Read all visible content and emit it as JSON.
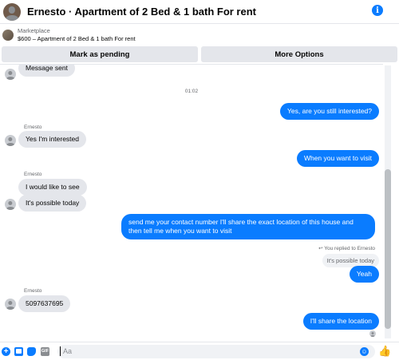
{
  "header": {
    "title": "Ernesto · Apartment of 2 Bed & 1 bath For rent",
    "info_icon": "info-icon",
    "info_glyph": "i"
  },
  "marketplace": {
    "kicker": "Marketplace",
    "listing": "$600 – Apartment of 2 Bed & 1 bath For rent"
  },
  "actions": {
    "pending_label": "Mark as pending",
    "more_label": "More Options"
  },
  "messages": [
    {
      "dir": "in",
      "text": "Message sent"
    },
    {
      "timestamp": "01:02"
    },
    {
      "dir": "out",
      "text": "Yes, are you still interested?"
    },
    {
      "sender": "Ernesto"
    },
    {
      "dir": "in",
      "text": "Yes I'm interested"
    },
    {
      "dir": "out",
      "text": "When you want to visit"
    },
    {
      "sender": "Ernesto"
    },
    {
      "dir": "in",
      "text": "I would like to see"
    },
    {
      "dir": "in",
      "text": "It's possible today"
    },
    {
      "dir": "out",
      "text": "send me your contact number I'll share the exact location of this house and then tell me when you want to visit"
    },
    {
      "replied_label": "You replied to Ernesto",
      "quoted": "It's possible today"
    },
    {
      "dir": "out",
      "text": "Yeah"
    },
    {
      "sender": "Ernesto"
    },
    {
      "dir": "in",
      "text": "5097637695"
    },
    {
      "dir": "out",
      "text": "I'll share the location"
    }
  ],
  "composer": {
    "placeholder": "Aa",
    "plus_glyph": "+",
    "gif_label": "GIF",
    "smile_glyph": "☺",
    "like_glyph": "👍"
  },
  "colors": {
    "accent": "#0a7cff",
    "incoming_bubble": "#e4e6eb"
  }
}
